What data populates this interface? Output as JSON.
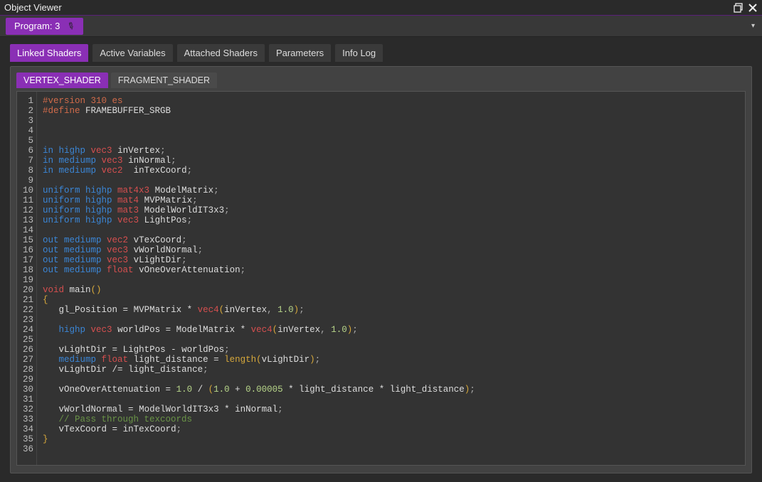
{
  "window": {
    "title": "Object Viewer"
  },
  "programbar": {
    "label": "Program: 3"
  },
  "tabs": {
    "items": [
      {
        "label": "Linked Shaders",
        "active": true
      },
      {
        "label": "Active Variables"
      },
      {
        "label": "Attached Shaders"
      },
      {
        "label": "Parameters"
      },
      {
        "label": "Info Log"
      }
    ]
  },
  "innerTabs": {
    "items": [
      {
        "label": "VERTEX_SHADER",
        "active": true
      },
      {
        "label": "FRAGMENT_SHADER"
      }
    ]
  },
  "code": {
    "lines": [
      [
        {
          "t": "#version ",
          "c": "c-pre"
        },
        {
          "t": "310 es",
          "c": "c-pre"
        }
      ],
      [
        {
          "t": "#define ",
          "c": "c-pre"
        },
        {
          "t": "FRAMEBUFFER_SRGB",
          "c": "c-id"
        }
      ],
      [],
      [],
      [],
      [
        {
          "t": "in ",
          "c": "c-kw"
        },
        {
          "t": "highp ",
          "c": "c-md"
        },
        {
          "t": "vec3",
          "c": "c-tp"
        },
        {
          "t": " inVertex",
          "c": "c-id"
        },
        {
          "t": ";",
          "c": "c-pu"
        }
      ],
      [
        {
          "t": "in ",
          "c": "c-kw"
        },
        {
          "t": "mediump ",
          "c": "c-md"
        },
        {
          "t": "vec3",
          "c": "c-tp"
        },
        {
          "t": " inNormal",
          "c": "c-id"
        },
        {
          "t": ";",
          "c": "c-pu"
        }
      ],
      [
        {
          "t": "in ",
          "c": "c-kw"
        },
        {
          "t": "mediump ",
          "c": "c-md"
        },
        {
          "t": "vec2",
          "c": "c-tp"
        },
        {
          "t": "  inTexCoord",
          "c": "c-id"
        },
        {
          "t": ";",
          "c": "c-pu"
        }
      ],
      [],
      [
        {
          "t": "uniform ",
          "c": "c-kw"
        },
        {
          "t": "highp ",
          "c": "c-md"
        },
        {
          "t": "mat4x3",
          "c": "c-tp"
        },
        {
          "t": " ModelMatrix",
          "c": "c-id"
        },
        {
          "t": ";",
          "c": "c-pu"
        }
      ],
      [
        {
          "t": "uniform ",
          "c": "c-kw"
        },
        {
          "t": "highp ",
          "c": "c-md"
        },
        {
          "t": "mat4",
          "c": "c-tp"
        },
        {
          "t": " MVPMatrix",
          "c": "c-id"
        },
        {
          "t": ";",
          "c": "c-pu"
        }
      ],
      [
        {
          "t": "uniform ",
          "c": "c-kw"
        },
        {
          "t": "highp ",
          "c": "c-md"
        },
        {
          "t": "mat3",
          "c": "c-tp"
        },
        {
          "t": " ModelWorldIT3x3",
          "c": "c-id"
        },
        {
          "t": ";",
          "c": "c-pu"
        }
      ],
      [
        {
          "t": "uniform ",
          "c": "c-kw"
        },
        {
          "t": "highp ",
          "c": "c-md"
        },
        {
          "t": "vec3",
          "c": "c-tp"
        },
        {
          "t": " LightPos",
          "c": "c-id"
        },
        {
          "t": ";",
          "c": "c-pu"
        }
      ],
      [],
      [
        {
          "t": "out ",
          "c": "c-kw"
        },
        {
          "t": "mediump ",
          "c": "c-md"
        },
        {
          "t": "vec2",
          "c": "c-tp"
        },
        {
          "t": " vTexCoord",
          "c": "c-id"
        },
        {
          "t": ";",
          "c": "c-pu"
        }
      ],
      [
        {
          "t": "out ",
          "c": "c-kw"
        },
        {
          "t": "mediump ",
          "c": "c-md"
        },
        {
          "t": "vec3",
          "c": "c-tp"
        },
        {
          "t": " vWorldNormal",
          "c": "c-id"
        },
        {
          "t": ";",
          "c": "c-pu"
        }
      ],
      [
        {
          "t": "out ",
          "c": "c-kw"
        },
        {
          "t": "mediump ",
          "c": "c-md"
        },
        {
          "t": "vec3",
          "c": "c-tp"
        },
        {
          "t": " vLightDir",
          "c": "c-id"
        },
        {
          "t": ";",
          "c": "c-pu"
        }
      ],
      [
        {
          "t": "out ",
          "c": "c-kw"
        },
        {
          "t": "mediump ",
          "c": "c-md"
        },
        {
          "t": "float",
          "c": "c-tp"
        },
        {
          "t": " vOneOverAttenuation",
          "c": "c-id"
        },
        {
          "t": ";",
          "c": "c-pu"
        }
      ],
      [],
      [
        {
          "t": "void",
          "c": "c-tp"
        },
        {
          "t": " main",
          "c": "c-id"
        },
        {
          "t": "()",
          "c": "c-br"
        }
      ],
      [
        {
          "t": "{",
          "c": "c-br"
        }
      ],
      [
        {
          "t": "   gl_Position ",
          "c": "c-id"
        },
        {
          "t": "= ",
          "c": "c-op"
        },
        {
          "t": "MVPMatrix ",
          "c": "c-id"
        },
        {
          "t": "* ",
          "c": "c-op"
        },
        {
          "t": "vec4",
          "c": "c-tp"
        },
        {
          "t": "(",
          "c": "c-br"
        },
        {
          "t": "inVertex",
          "c": "c-id"
        },
        {
          "t": ", ",
          "c": "c-pu"
        },
        {
          "t": "1.0",
          "c": "c-nm"
        },
        {
          "t": ")",
          "c": "c-br"
        },
        {
          "t": ";",
          "c": "c-pu"
        }
      ],
      [],
      [
        {
          "t": "   ",
          "c": ""
        },
        {
          "t": "highp ",
          "c": "c-md"
        },
        {
          "t": "vec3",
          "c": "c-tp"
        },
        {
          "t": " worldPos ",
          "c": "c-id"
        },
        {
          "t": "= ",
          "c": "c-op"
        },
        {
          "t": "ModelMatrix ",
          "c": "c-id"
        },
        {
          "t": "* ",
          "c": "c-op"
        },
        {
          "t": "vec4",
          "c": "c-tp"
        },
        {
          "t": "(",
          "c": "c-br"
        },
        {
          "t": "inVertex",
          "c": "c-id"
        },
        {
          "t": ", ",
          "c": "c-pu"
        },
        {
          "t": "1.0",
          "c": "c-nm"
        },
        {
          "t": ")",
          "c": "c-br"
        },
        {
          "t": ";",
          "c": "c-pu"
        }
      ],
      [],
      [
        {
          "t": "   vLightDir ",
          "c": "c-id"
        },
        {
          "t": "= ",
          "c": "c-op"
        },
        {
          "t": "LightPos ",
          "c": "c-id"
        },
        {
          "t": "- ",
          "c": "c-op"
        },
        {
          "t": "worldPos",
          "c": "c-id"
        },
        {
          "t": ";",
          "c": "c-pu"
        }
      ],
      [
        {
          "t": "   ",
          "c": ""
        },
        {
          "t": "mediump ",
          "c": "c-md"
        },
        {
          "t": "float",
          "c": "c-tp"
        },
        {
          "t": " light_distance ",
          "c": "c-id"
        },
        {
          "t": "= ",
          "c": "c-op"
        },
        {
          "t": "length",
          "c": "c-fn"
        },
        {
          "t": "(",
          "c": "c-br"
        },
        {
          "t": "vLightDir",
          "c": "c-id"
        },
        {
          "t": ")",
          "c": "c-br"
        },
        {
          "t": ";",
          "c": "c-pu"
        }
      ],
      [
        {
          "t": "   vLightDir ",
          "c": "c-id"
        },
        {
          "t": "/= ",
          "c": "c-op"
        },
        {
          "t": "light_distance",
          "c": "c-id"
        },
        {
          "t": ";",
          "c": "c-pu"
        }
      ],
      [],
      [
        {
          "t": "   vOneOverAttenuation ",
          "c": "c-id"
        },
        {
          "t": "= ",
          "c": "c-op"
        },
        {
          "t": "1.0",
          "c": "c-nm"
        },
        {
          "t": " / ",
          "c": "c-op"
        },
        {
          "t": "(",
          "c": "c-br"
        },
        {
          "t": "1.0",
          "c": "c-nm"
        },
        {
          "t": " + ",
          "c": "c-op"
        },
        {
          "t": "0.00005",
          "c": "c-nm"
        },
        {
          "t": " * ",
          "c": "c-op"
        },
        {
          "t": "light_distance ",
          "c": "c-id"
        },
        {
          "t": "* ",
          "c": "c-op"
        },
        {
          "t": "light_distance",
          "c": "c-id"
        },
        {
          "t": ")",
          "c": "c-br"
        },
        {
          "t": ";",
          "c": "c-pu"
        }
      ],
      [],
      [
        {
          "t": "   vWorldNormal ",
          "c": "c-id"
        },
        {
          "t": "= ",
          "c": "c-op"
        },
        {
          "t": "ModelWorldIT3x3 ",
          "c": "c-id"
        },
        {
          "t": "* ",
          "c": "c-op"
        },
        {
          "t": "inNormal",
          "c": "c-id"
        },
        {
          "t": ";",
          "c": "c-pu"
        }
      ],
      [
        {
          "t": "   // Pass through texcoords",
          "c": "c-cm"
        }
      ],
      [
        {
          "t": "   vTexCoord ",
          "c": "c-id"
        },
        {
          "t": "= ",
          "c": "c-op"
        },
        {
          "t": "inTexCoord",
          "c": "c-id"
        },
        {
          "t": ";",
          "c": "c-pu"
        }
      ],
      [
        {
          "t": "}",
          "c": "c-br"
        }
      ],
      []
    ]
  }
}
